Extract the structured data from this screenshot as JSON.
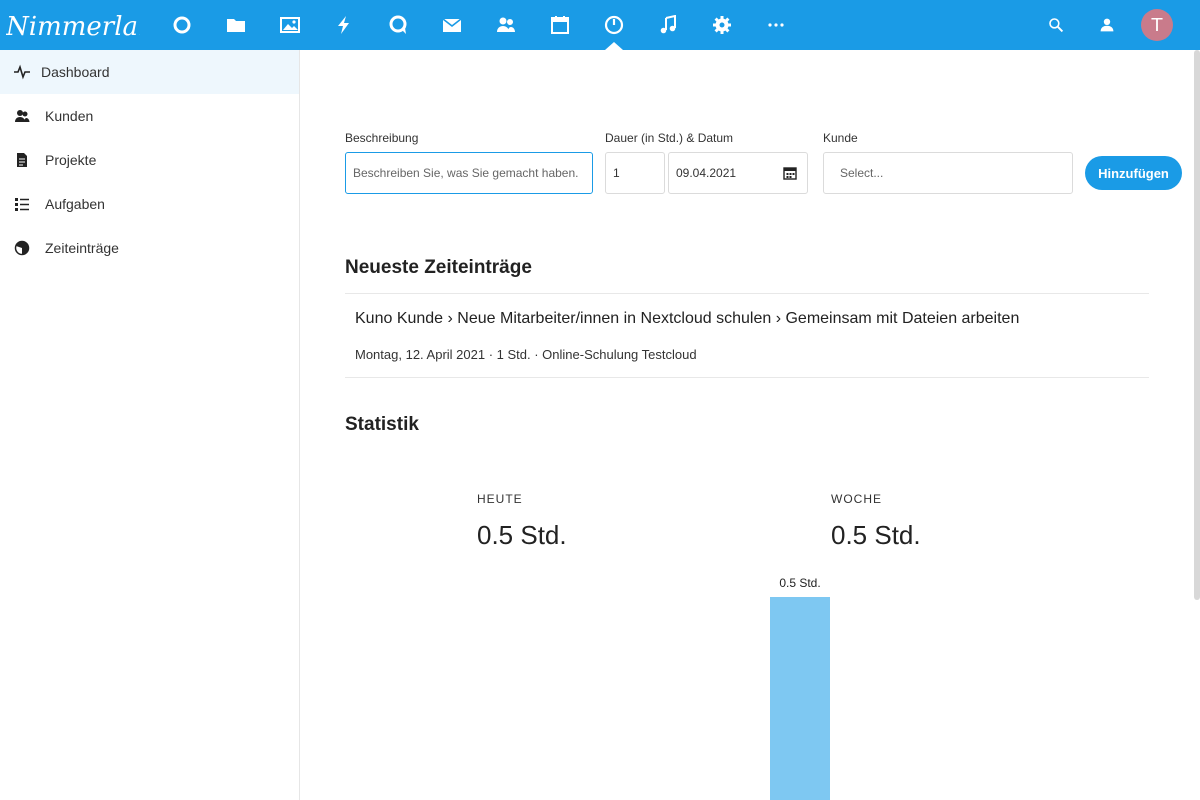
{
  "header": {
    "logo_text": "Nimmerland",
    "avatar_initial": "T",
    "nav_icons": [
      "dashboard-circle-icon",
      "files-icon",
      "photos-icon",
      "activity-icon",
      "talk-icon",
      "mail-icon",
      "contacts-icon",
      "calendar-icon",
      "timetracker-icon",
      "music-icon",
      "settings-icon",
      "more-icon"
    ],
    "right_icons": [
      "search-icon",
      "contacts-menu-icon"
    ]
  },
  "sidebar": {
    "items": [
      {
        "label": "Dashboard",
        "icon": "pulse-icon",
        "active": true
      },
      {
        "label": "Kunden",
        "icon": "customers-icon",
        "active": false
      },
      {
        "label": "Projekte",
        "icon": "document-icon",
        "active": false
      },
      {
        "label": "Aufgaben",
        "icon": "tasks-icon",
        "active": false
      },
      {
        "label": "Zeiteinträge",
        "icon": "pie-icon",
        "active": false
      }
    ]
  },
  "form": {
    "description_label": "Beschreibung",
    "description_placeholder": "Beschreiben Sie, was Sie gemacht haben.",
    "duration_label": "Dauer (in Std.) & Datum",
    "duration_value": "1",
    "date_value": "09.04.2021",
    "customer_label": "Kunde",
    "customer_placeholder": "Select...",
    "add_button": "Hinzufügen"
  },
  "recent": {
    "title": "Neueste Zeiteinträge",
    "entries": [
      {
        "path": "Kuno Kunde › Neue Mitarbeiter/innen in Nextcloud schulen › Gemeinsam mit Dateien arbeiten",
        "meta": "Montag, 12. April 2021 · 1 Std. · Online-Schulung Testcloud"
      }
    ]
  },
  "stats": {
    "title": "Statistik",
    "today_label": "HEUTE",
    "today_value": "0.5 Std.",
    "week_label": "WOCHE",
    "week_value": "0.5 Std."
  },
  "chart_data": {
    "type": "bar",
    "categories": [
      ""
    ],
    "values": [
      0.5
    ],
    "data_labels": [
      "0.5 Std."
    ],
    "color": "#7ec8f2"
  },
  "colors": {
    "accent": "#1a9be6",
    "bar": "#7ec8f2",
    "avatar": "#c97b8b"
  }
}
